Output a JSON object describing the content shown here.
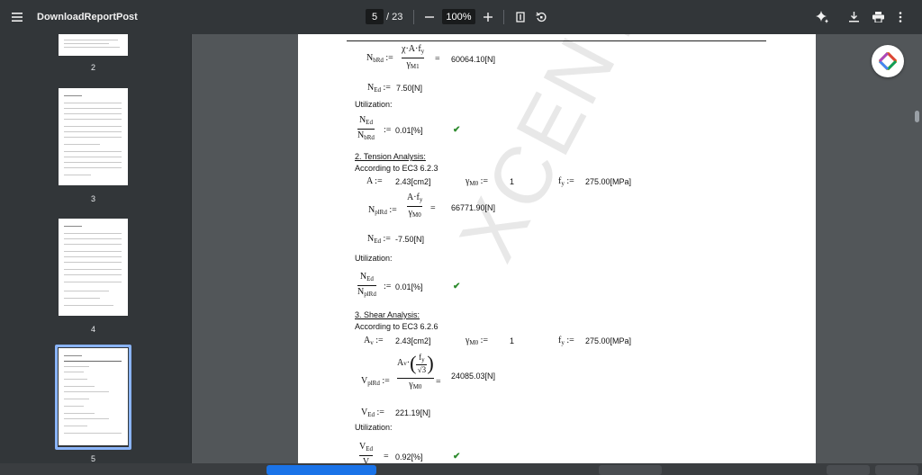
{
  "toolbar": {
    "title": "DownloadReportPost",
    "current_page": "5",
    "total_pages": "/ 23",
    "zoom": "100%"
  },
  "sidebar": {
    "thumbnails": [
      {
        "label": "2"
      },
      {
        "label": "3"
      },
      {
        "label": "4"
      },
      {
        "label": "5"
      }
    ]
  },
  "doc": {
    "nbrd_lhs": "N",
    "nbrd_lhs_sub": "bRd",
    "nbrd_num": "χ·A·f",
    "nbrd_num_sub": "y",
    "nbrd_den": "γ",
    "nbrd_den_sub": "M1",
    "nbrd_value": "60064.10[N]",
    "ned1_lhs": "N",
    "ned1_lhs_sub": "Ed",
    "ned1_value": "7.50[N]",
    "util1": "Utilization:",
    "ratio1_num": "N",
    "ratio1_num_sub": "Ed",
    "ratio1_den": "N",
    "ratio1_den_sub": "bRd",
    "ratio1_value": "0.01[%]",
    "tension_heading": "2. Tension Analysis:",
    "tension_ref": "According to EC3 6.2.3",
    "a_lhs": "A",
    "a_value": "2.43[cm2]",
    "gm0_lhs": "γ",
    "gm0_lhs_sub": "M0",
    "gm0_value": "1",
    "fy_lhs": "f",
    "fy_lhs_sub": "y",
    "fy_value": "275.00[MPa]",
    "nplrd_lhs": "N",
    "nplrd_lhs_sub": "plRd",
    "nplrd_num": "A·f",
    "nplrd_num_sub": "y",
    "nplrd_den": "γ",
    "nplrd_den_sub": "M0",
    "nplrd_value": "66771.90[N]",
    "ned2_lhs": "N",
    "ned2_lhs_sub": "Ed",
    "ned2_value": "-7.50[N]",
    "util2": "Utilization:",
    "ratio2_num": "N",
    "ratio2_num_sub": "Ed",
    "ratio2_den": "N",
    "ratio2_den_sub": "plRd",
    "ratio2_value": "0.01[%]",
    "shear_heading": "3. Shear Analysis:",
    "shear_ref": "According to EC3 6.2.6",
    "av_lhs": "A",
    "av_lhs_sub": "v",
    "av_value": "2.43[cm2]",
    "gm0b_lhs": "γ",
    "gm0b_lhs_sub": "M0",
    "gm0b_value": "1",
    "fyb_lhs": "f",
    "fyb_lhs_sub": "y",
    "fyb_value": "275.00[MPa]",
    "vplrd_lhs": "V",
    "vplrd_lhs_sub": "plRd",
    "vplrd_num_a": "A",
    "vplrd_num_a_sub": "v",
    "vplrd_inner_num": "f",
    "vplrd_inner_num_sub": "y",
    "vplrd_inner_den": "√3",
    "vplrd_den": "γ",
    "vplrd_den_sub": "M0",
    "vplrd_value": "24085.03[N]",
    "ved_lhs": "V",
    "ved_lhs_sub": "Ed",
    "ved_value": "221.19[N]",
    "util3": "Utilization:",
    "ratio3_num": "V",
    "ratio3_num_sub": "Ed",
    "ratio3_den": "V",
    "ratio3_value": "0.92[%]",
    "watermark": "XCENTER"
  },
  "colors": {
    "toolbar_bg": "#323639",
    "viewer_bg": "#525659",
    "check": "#2e8b2e",
    "selected_thumb_border": "#8ab4f8"
  }
}
